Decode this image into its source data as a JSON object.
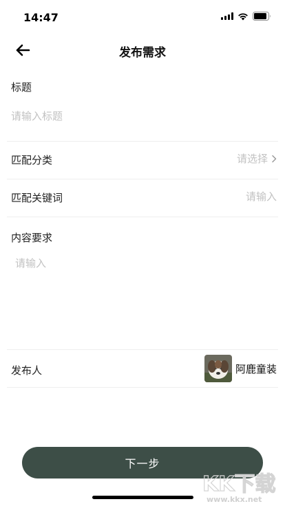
{
  "status_bar": {
    "time": "14:47"
  },
  "nav": {
    "title": "发布需求"
  },
  "form": {
    "title_label": "标题",
    "title_placeholder": "请输入标题",
    "category_label": "匹配分类",
    "category_value": "请选择",
    "keyword_label": "匹配关键词",
    "keyword_placeholder": "请输入",
    "content_label": "内容要求",
    "content_placeholder": "请输入",
    "publisher_label": "发布人",
    "publisher_name": "阿鹿童装"
  },
  "footer": {
    "next_label": "下一步"
  },
  "watermark": {
    "line1": "KK下载",
    "line2": "www.kkx.net"
  },
  "colors": {
    "button_bg": "#3d4e47",
    "placeholder": "#c2c2c2"
  }
}
